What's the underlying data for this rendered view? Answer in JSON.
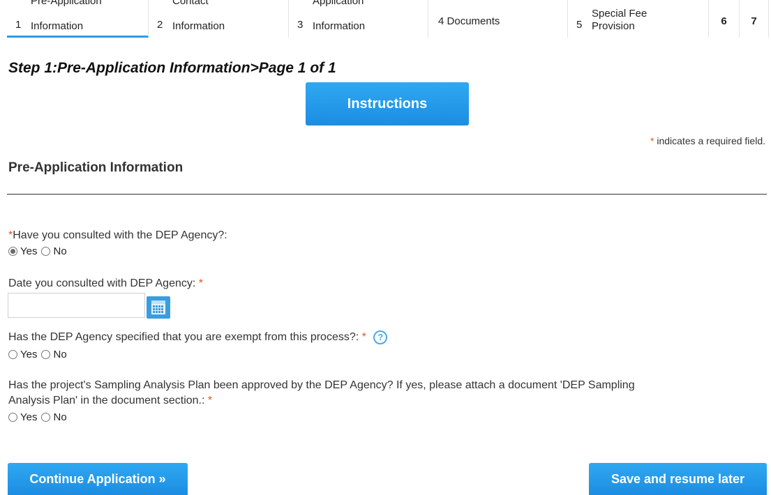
{
  "tabs": [
    {
      "num": "1",
      "line1": "Pre-Application",
      "line2": "Information"
    },
    {
      "num": "2",
      "line1": "Contact",
      "line2": "Information"
    },
    {
      "num": "3",
      "line1": "Application",
      "line2": "Information"
    },
    {
      "num": "4",
      "label": "Documents"
    },
    {
      "num": "5",
      "line1": "Special Fee",
      "line2": "Provision"
    },
    {
      "num": "6"
    },
    {
      "num": "7"
    }
  ],
  "page": {
    "step_title": "Step 1:Pre-Application Information>Page 1 of 1",
    "instructions_label": "Instructions",
    "required_star": "*",
    "required_note": "indicates a required field.",
    "section_title": "Pre-Application Information"
  },
  "form": {
    "q1": {
      "star": "*",
      "label": "Have you consulted with the DEP Agency?:",
      "yes": "Yes",
      "no": "No",
      "selected": "Yes"
    },
    "q2": {
      "label": "Date you consulted with DEP Agency:",
      "star": "*",
      "value": ""
    },
    "q3": {
      "label": "Has the DEP Agency specified that you are exempt from this process?:",
      "star": "*",
      "help": "?",
      "yes": "Yes",
      "no": "No"
    },
    "q4": {
      "label_line1": "Has the project's Sampling Analysis Plan been approved by the DEP Agency? If yes, please attach a document 'DEP Sampling",
      "label_line2": "Analysis Plan' in the document section.:",
      "star": "*",
      "yes": "Yes",
      "no": "No"
    }
  },
  "actions": {
    "continue_label": "Continue Application »",
    "save_label": "Save and resume later"
  },
  "colors": {
    "accent": "#1c8de2",
    "required": "#e2571b"
  }
}
